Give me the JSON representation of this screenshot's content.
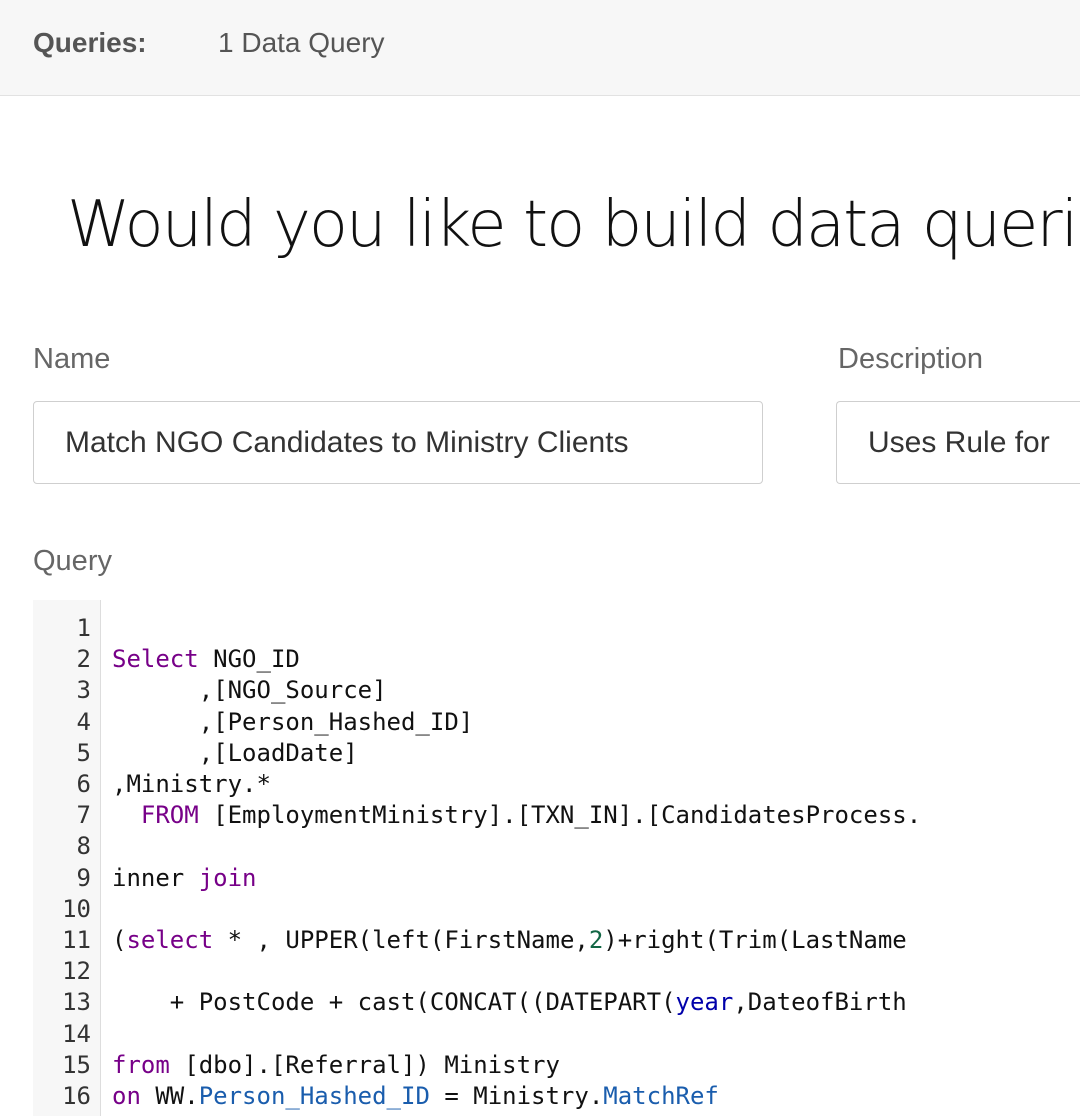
{
  "header": {
    "queries_label": "Queries:",
    "queries_value": "1 Data Query"
  },
  "heading": "Would you like to build data querie",
  "form": {
    "name_label": "Name",
    "name_value": "Match NGO Candidates to Ministry Clients",
    "description_label": "Description",
    "description_value": "Uses Rule for",
    "query_label": "Query"
  },
  "code_lines": [
    {
      "n": "1",
      "tokens": [
        {
          "t": "",
          "c": ""
        }
      ]
    },
    {
      "n": "2",
      "tokens": [
        {
          "t": "Select",
          "c": "kw"
        },
        {
          "t": " NGO_ID",
          "c": ""
        }
      ]
    },
    {
      "n": "3",
      "tokens": [
        {
          "t": "      ,[NGO_Source]",
          "c": ""
        }
      ]
    },
    {
      "n": "4",
      "tokens": [
        {
          "t": "      ,[Person_Hashed_ID]",
          "c": ""
        }
      ]
    },
    {
      "n": "5",
      "tokens": [
        {
          "t": "      ,[LoadDate]",
          "c": ""
        }
      ]
    },
    {
      "n": "6",
      "tokens": [
        {
          "t": ",Ministry.*",
          "c": ""
        }
      ]
    },
    {
      "n": "7",
      "tokens": [
        {
          "t": "  ",
          "c": ""
        },
        {
          "t": "FROM",
          "c": "kw"
        },
        {
          "t": " [EmploymentMinistry].[TXN_IN].[CandidatesProcess.",
          "c": ""
        }
      ]
    },
    {
      "n": "8",
      "tokens": [
        {
          "t": "",
          "c": ""
        }
      ]
    },
    {
      "n": "9",
      "tokens": [
        {
          "t": "inner ",
          "c": ""
        },
        {
          "t": "join",
          "c": "kw"
        }
      ]
    },
    {
      "n": "10",
      "tokens": [
        {
          "t": "",
          "c": ""
        }
      ]
    },
    {
      "n": "11",
      "tokens": [
        {
          "t": "(",
          "c": ""
        },
        {
          "t": "select",
          "c": "kw"
        },
        {
          "t": " * , UPPER(left(FirstName,",
          "c": ""
        },
        {
          "t": "2",
          "c": "nm"
        },
        {
          "t": ")+right(Trim(LastName",
          "c": ""
        }
      ]
    },
    {
      "n": "12",
      "tokens": [
        {
          "t": "",
          "c": ""
        }
      ]
    },
    {
      "n": "13",
      "tokens": [
        {
          "t": "    + PostCode + cast(CONCAT((DATEPART(",
          "c": ""
        },
        {
          "t": "year",
          "c": "fn"
        },
        {
          "t": ",DateofBirth",
          "c": ""
        }
      ]
    },
    {
      "n": "14",
      "tokens": [
        {
          "t": "",
          "c": ""
        }
      ]
    },
    {
      "n": "15",
      "tokens": [
        {
          "t": "from",
          "c": "kw"
        },
        {
          "t": " [dbo].[Referral]) Ministry",
          "c": ""
        }
      ]
    },
    {
      "n": "16",
      "tokens": [
        {
          "t": "on",
          "c": "kw"
        },
        {
          "t": " WW.",
          "c": ""
        },
        {
          "t": "Person_Hashed_ID",
          "c": "at"
        },
        {
          "t": " = Ministry.",
          "c": ""
        },
        {
          "t": "MatchRef",
          "c": "at"
        }
      ]
    }
  ]
}
